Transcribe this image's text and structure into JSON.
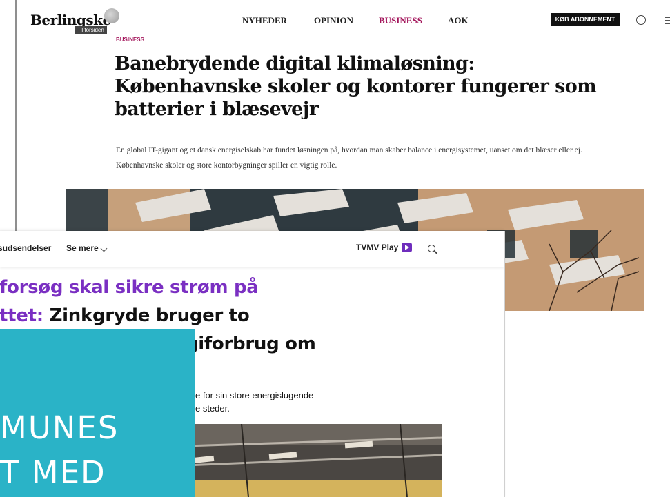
{
  "berlingske": {
    "logo": "Berlingske",
    "home_link": "Til forsiden",
    "nav": [
      "NYHEDER",
      "OPINION",
      "BUSINESS",
      "AOK"
    ],
    "subscribe": "KØB ABONNEMENT",
    "kicker": "BUSINESS",
    "headline": "Banebrydende digital klimaløsning: Københavnske skoler og kontorer fungerer som batterier i blæsevejr",
    "lede": "En global IT-gigant og et dansk energiselskab har fundet løsningen på, hvordan man skaber balance i energisystemet, uanset om det blæser eller ej. Københavnske skoler og store kontorbygninger spiller en vigtig rolle.",
    "icons": [
      "crest-icon",
      "user-icon",
      "menu-icon"
    ]
  },
  "tvmv": {
    "nav_left": "sudsendelser",
    "more": "Se mere",
    "play_label": "TVMV Play",
    "headline_accent": "forsøg skal sikre strøm på",
    "headline_line2_accent": "ttet:",
    "headline_line2_rest": " Zinkgryde bruger to",
    "headline_line3": "giforbrug om",
    "lede_line1": "e for sin store energislugende",
    "lede_line2": "e steder.",
    "colors": {
      "accent": "#7a2fc2"
    }
  },
  "overlay": {
    "line1": "MUNES",
    "line2": "T MED",
    "color": "#2ab3c7"
  }
}
